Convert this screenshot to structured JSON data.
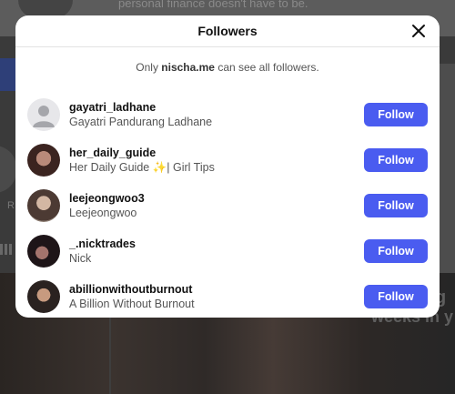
{
  "background": {
    "top_text": "personal finance doesn't have to be.",
    "side_letter": "R",
    "right_text_1": "weeks in y",
    "right_text_2": "g"
  },
  "modal": {
    "title": "Followers",
    "close_icon": "close-icon",
    "notice_prefix": "Only ",
    "notice_account": "nischa.me",
    "notice_suffix": " can see all followers."
  },
  "followers": [
    {
      "username": "gayatri_ladhane",
      "full_name": "Gayatri Pandurang Ladhane",
      "button": "Follow"
    },
    {
      "username": "her_daily_guide",
      "full_name": "Her Daily Guide ✨| Girl Tips",
      "button": "Follow"
    },
    {
      "username": "leejeongwoo3",
      "full_name": "Leejeongwoo",
      "button": "Follow"
    },
    {
      "username": "_.nicktrades",
      "full_name": "Nick",
      "button": "Follow"
    },
    {
      "username": "abillionwithoutburnout",
      "full_name": "A Billion Without Burnout",
      "button": "Follow"
    }
  ],
  "colors": {
    "follow_button": "#4a5cf0",
    "overlay": "#3a3a3a"
  }
}
